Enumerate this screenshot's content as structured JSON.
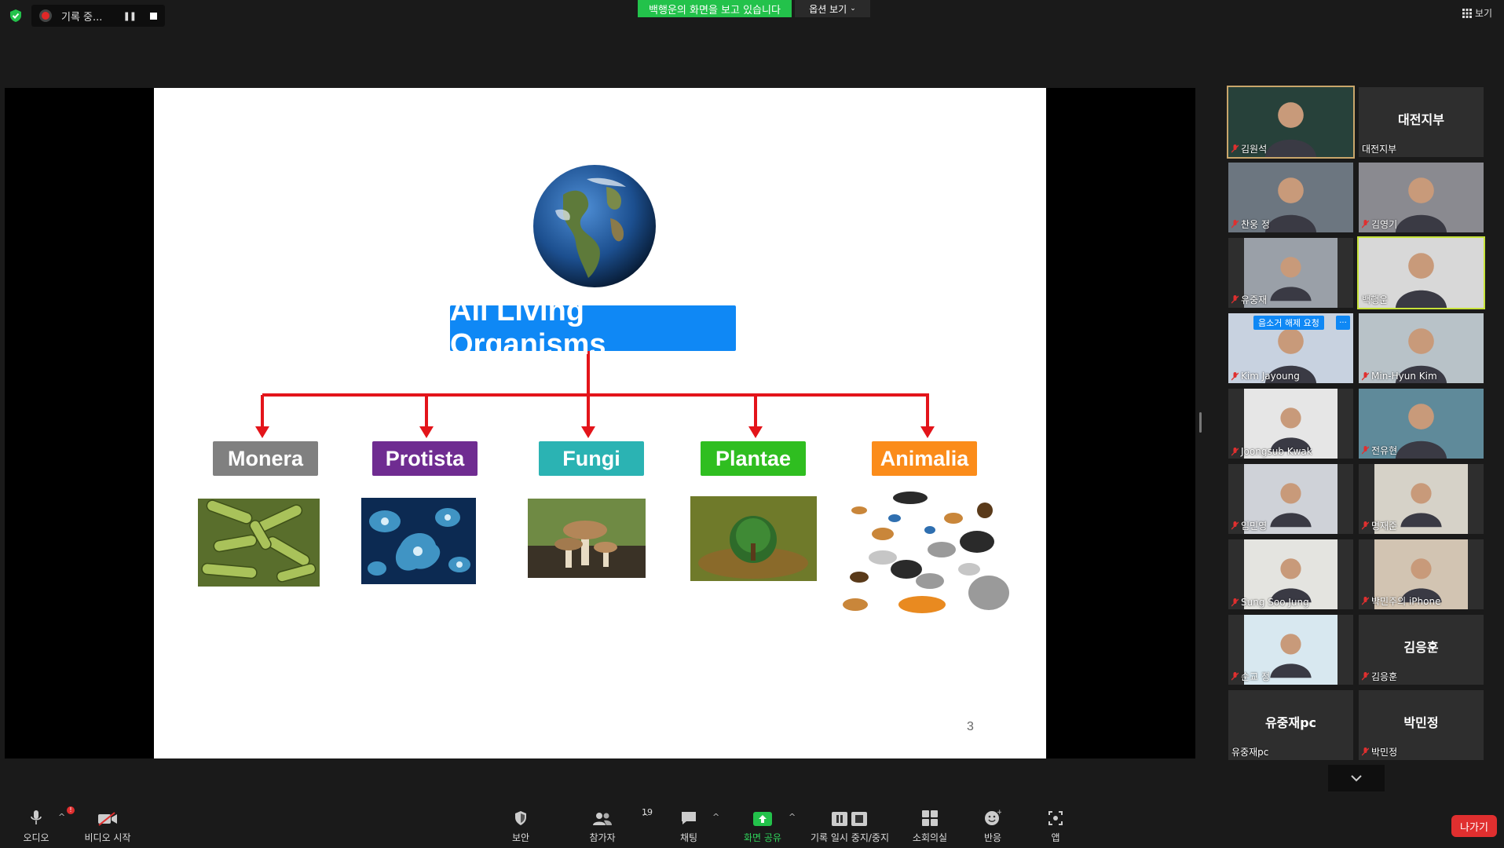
{
  "topbar": {
    "recording_label": "기록 중...",
    "viewing_banner": "백행운의 화면을 보고 있습니다",
    "view_options_label": "옵션 보기",
    "view_label": "보기"
  },
  "slide": {
    "title": "All Living Organisms",
    "categories": [
      {
        "label": "Monera",
        "color": "#808080"
      },
      {
        "label": "Protista",
        "color": "#6f2c91"
      },
      {
        "label": "Fungi",
        "color": "#2bb3b3"
      },
      {
        "label": "Plantae",
        "color": "#2fbe20"
      },
      {
        "label": "Animalia",
        "color": "#fb8c1a"
      }
    ],
    "page_number": "3"
  },
  "gallery": {
    "tiles": [
      {
        "name": "김원석",
        "muted": true,
        "big": ""
      },
      {
        "name": "대전지부",
        "muted": false,
        "big": "대전지부"
      },
      {
        "name": "찬웅 정",
        "muted": true,
        "big": ""
      },
      {
        "name": "김영기",
        "muted": true,
        "big": ""
      },
      {
        "name": "유중재",
        "muted": true,
        "big": ""
      },
      {
        "name": "백행운",
        "muted": false,
        "big": ""
      },
      {
        "name": "Kim Jayoung",
        "muted": true,
        "big": ""
      },
      {
        "name": "Min-Hyun Kim",
        "muted": true,
        "big": ""
      },
      {
        "name": "Joongsub Kwak",
        "muted": true,
        "big": ""
      },
      {
        "name": "전유현",
        "muted": true,
        "big": ""
      },
      {
        "name": "임민영",
        "muted": true,
        "big": ""
      },
      {
        "name": "명재준",
        "muted": true,
        "big": ""
      },
      {
        "name": "Sung Soo Jung",
        "muted": true,
        "big": ""
      },
      {
        "name": "박민주의 iPhone",
        "muted": true,
        "big": ""
      },
      {
        "name": "순교 정",
        "muted": true,
        "big": ""
      },
      {
        "name": "김응훈",
        "muted": true,
        "big": "김응훈"
      },
      {
        "name": "유중재pc",
        "muted": false,
        "big": "유중재pc"
      },
      {
        "name": "박민정",
        "muted": true,
        "big": "박민정"
      }
    ],
    "unmute_request_label": "음소거 해제 요청",
    "more_label": "···"
  },
  "toolbar": {
    "audio": "오디오",
    "video": "비디오 시작",
    "security": "보안",
    "participants": "참가자",
    "participants_count": "19",
    "chat": "채팅",
    "share_screen": "화면 공유",
    "pause_stop_recording": "기록 일시 중지/중지",
    "breakout_rooms": "소회의실",
    "reactions": "반응",
    "apps": "앱",
    "leave": "나가기",
    "audio_badge": "!"
  },
  "colors": {
    "accent_blue": "#0f88f5",
    "zoom_green": "#23c24b",
    "leave_red": "#e02f2f",
    "arrow_red": "#e3141a"
  }
}
